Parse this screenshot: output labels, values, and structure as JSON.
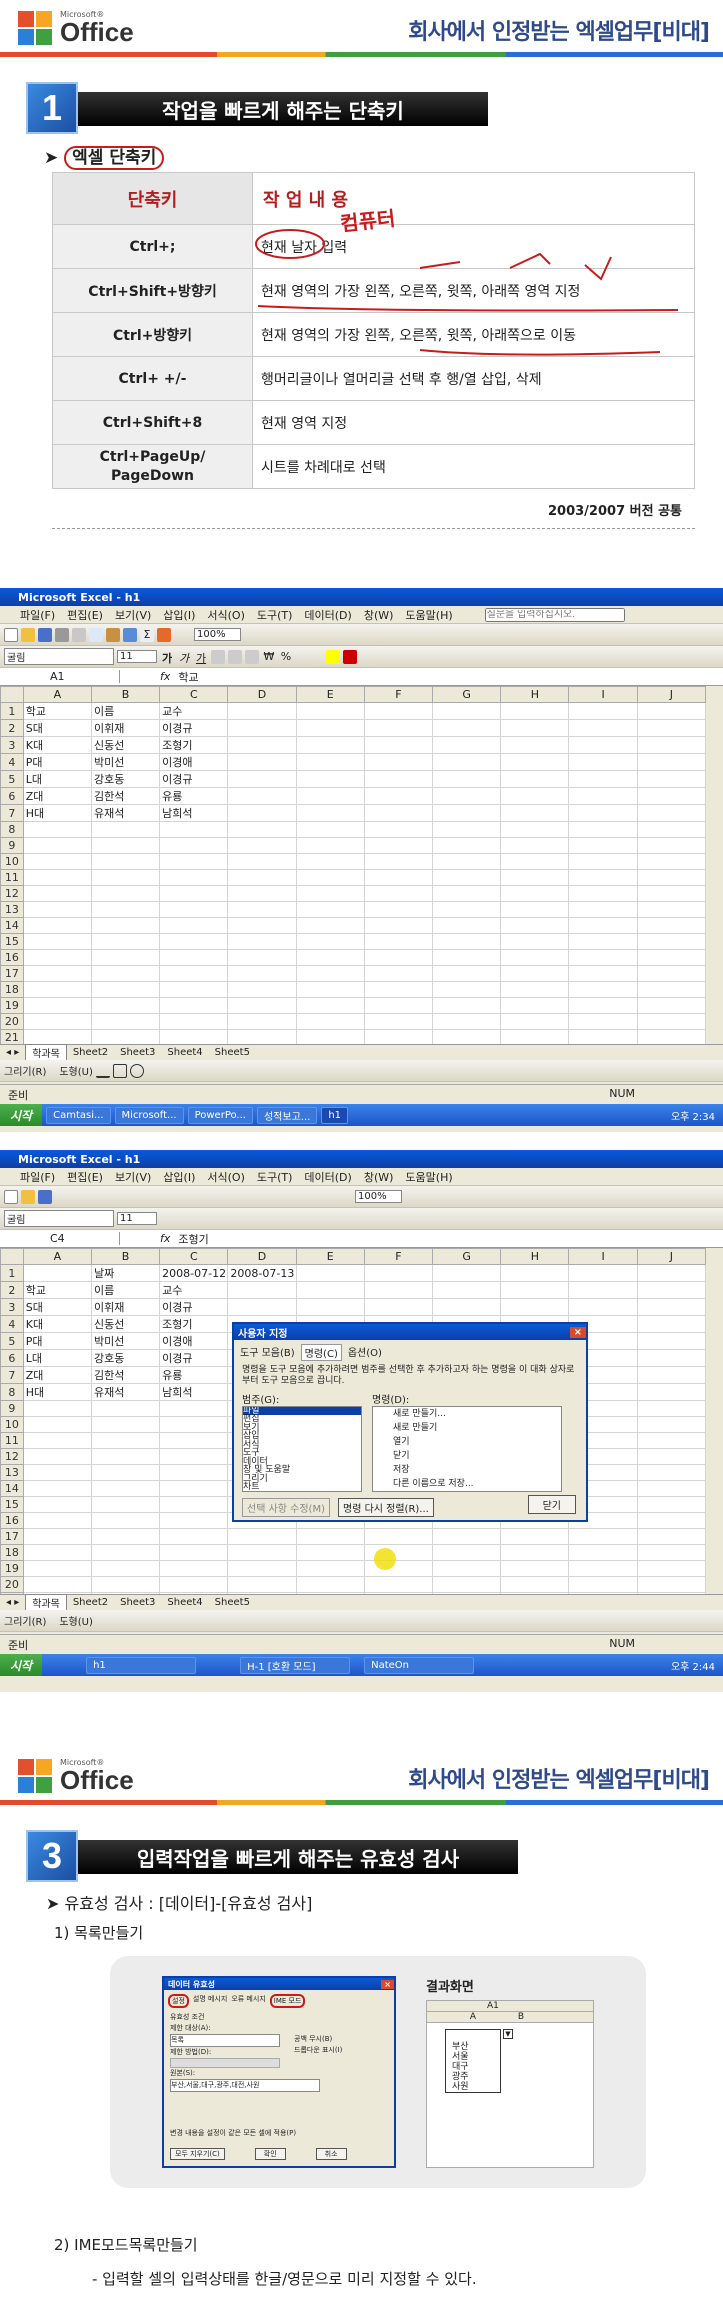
{
  "slide1": {
    "logo_ms": "Microsoft®",
    "logo_word": "Office",
    "banner": "회사에서 인정받는 엑셀업무[비대]",
    "section_num": "1",
    "section_title": "작업을 빠르게 해주는 단축키",
    "subheading": "엑셀 단축키",
    "table_head": [
      "단축키",
      "작 업 내 용"
    ],
    "rows": [
      {
        "key": "Ctrl+;",
        "desc": "현재 날자 입력"
      },
      {
        "key": "Ctrl+Shift+방향키",
        "desc": "현재 영역의 가장 왼쪽, 오른쪽, 윗쪽, 아래쪽 영역 지정"
      },
      {
        "key": "Ctrl+방향키",
        "desc": "현재 영역의 가장 왼쪽, 오른쪽, 윗쪽, 아래쪽으로 이동"
      },
      {
        "key": "Ctrl+ +/-",
        "desc": "행머리글이나 열머리글 선택 후 행/열 삽입, 삭제"
      },
      {
        "key": "Ctrl+Shift+8",
        "desc": "현재 영역 지정"
      },
      {
        "key": "Ctrl+PageUp/\nPageDown",
        "desc": "시트를 차례대로 선택"
      }
    ],
    "annotation": "컴퓨터",
    "footer": "2003/2007 버전 공통"
  },
  "excel1": {
    "title": "Microsoft Excel - h1",
    "menu": [
      "파일(F)",
      "편집(E)",
      "보기(V)",
      "삽입(I)",
      "서식(O)",
      "도구(T)",
      "데이터(D)",
      "창(W)",
      "도움말(H)"
    ],
    "help_placeholder": "질문을 입력하십시오.",
    "font": "굴림",
    "size": "11",
    "zoom": "100%",
    "namebox": "A1",
    "formula": "학교",
    "cols": [
      "A",
      "B",
      "C",
      "D",
      "E",
      "F",
      "G",
      "H",
      "I",
      "J"
    ],
    "cells": [
      [
        "학교",
        "이름",
        "교수"
      ],
      [
        "S대",
        "이휘재",
        "이경규"
      ],
      [
        "K대",
        "신동선",
        "조형기"
      ],
      [
        "P대",
        "박미선",
        "이경애"
      ],
      [
        "L대",
        "강호동",
        "이경규"
      ],
      [
        "Z대",
        "김한석",
        "유룡"
      ],
      [
        "H대",
        "유재석",
        "남희석"
      ]
    ],
    "row_count": 21,
    "tabs": [
      "학과목",
      "Sheet2",
      "Sheet3",
      "Sheet4",
      "Sheet5"
    ],
    "drawing": "그리기(R)",
    "shapes": "도형(U)",
    "status_left": "준비",
    "status_right": "NUM",
    "start": "시작",
    "task_items": [
      "Camtasi...",
      "Microsoft...",
      "PowerPo...",
      "성적보고...",
      "h1"
    ],
    "clock": "오후 2:34"
  },
  "excel2": {
    "title": "Microsoft Excel - h1",
    "namebox": "C4",
    "formula": "조형기",
    "row1": [
      "",
      "날짜",
      "2008-07-12",
      "2008-07-13"
    ],
    "cells": [
      [
        "학교",
        "이름",
        "교수"
      ],
      [
        "S대",
        "이휘재",
        "이경규"
      ],
      [
        "K대",
        "신동선",
        "조형기"
      ],
      [
        "P대",
        "박미선",
        "이경애"
      ],
      [
        "L대",
        "강호동",
        "이경규"
      ],
      [
        "Z대",
        "김한석",
        "유룡"
      ],
      [
        "H대",
        "유재석",
        "남희석"
      ]
    ],
    "dialog": {
      "title": "사용자 지정",
      "tabs": [
        "도구 모음(B)",
        "명령(C)",
        "옵션(O)"
      ],
      "desc": "명령을 도구 모음에 추가하려면 범주를 선택한 후 추가하고자 하는 명령을 이 대화 상자로부터 도구 모음으로 끕니다.",
      "cat_label": "범주(G):",
      "cmd_label": "명령(D):",
      "categories": [
        "파일",
        "편집",
        "보기",
        "삽입",
        "서식",
        "도구",
        "데이터",
        "창 및 도움말",
        "그리기",
        "차트"
      ],
      "commands": [
        "새로 만들기...",
        "새로 만들기",
        "열기",
        "닫기",
        "저장",
        "다른 이름으로 저장..."
      ],
      "modify_btn": "선택 사항 수정(M)",
      "rearrange_btn": "명령 다시 정렬(R)...",
      "close_btn": "닫기"
    },
    "task_items": [
      "h1",
      "H-1 [호환 모드]",
      "NateOn"
    ],
    "clock": "오후 2:44"
  },
  "slide3": {
    "banner": "회사에서 인정받는 엑셀업무[비대]",
    "section_num": "3",
    "section_title": "입력작업을 빠르게 해주는 유효성 검사",
    "line1": "유효성 검사 : [데이터]-[유효성 검사]",
    "line2": "1) 목록만들기",
    "result_label": "결과화면",
    "vdlg_title": "데이터 유효성",
    "vdlg_tabs": [
      "설정",
      "설명 메시지",
      "오류 메시지",
      "IME 모드"
    ],
    "vdlg_fields": [
      "유효성 조건",
      "제한 대상(A):",
      "목록",
      "제한 방법(D):",
      "원본(S):",
      "부산,서울,대구,광주,대전,사원"
    ],
    "vdlg_checks": [
      "공백 무시(B)",
      "드롭다운 표시(I)"
    ],
    "vdlg_buttons": [
      "모두 지우기(C)",
      "확인",
      "취소"
    ],
    "vdlg_bottom": "변경 내용을 설정이 같은 모든 셀에 적용(P)",
    "mini_namebox": "A1",
    "mini_list": [
      "부산",
      "서울",
      "대구",
      "광주",
      "사원"
    ],
    "line3": "2) IME모드목록만들기",
    "line4": "- 입력할 셀의 입력상태를 한글/영문으로 미리 지정할 수 있다."
  }
}
